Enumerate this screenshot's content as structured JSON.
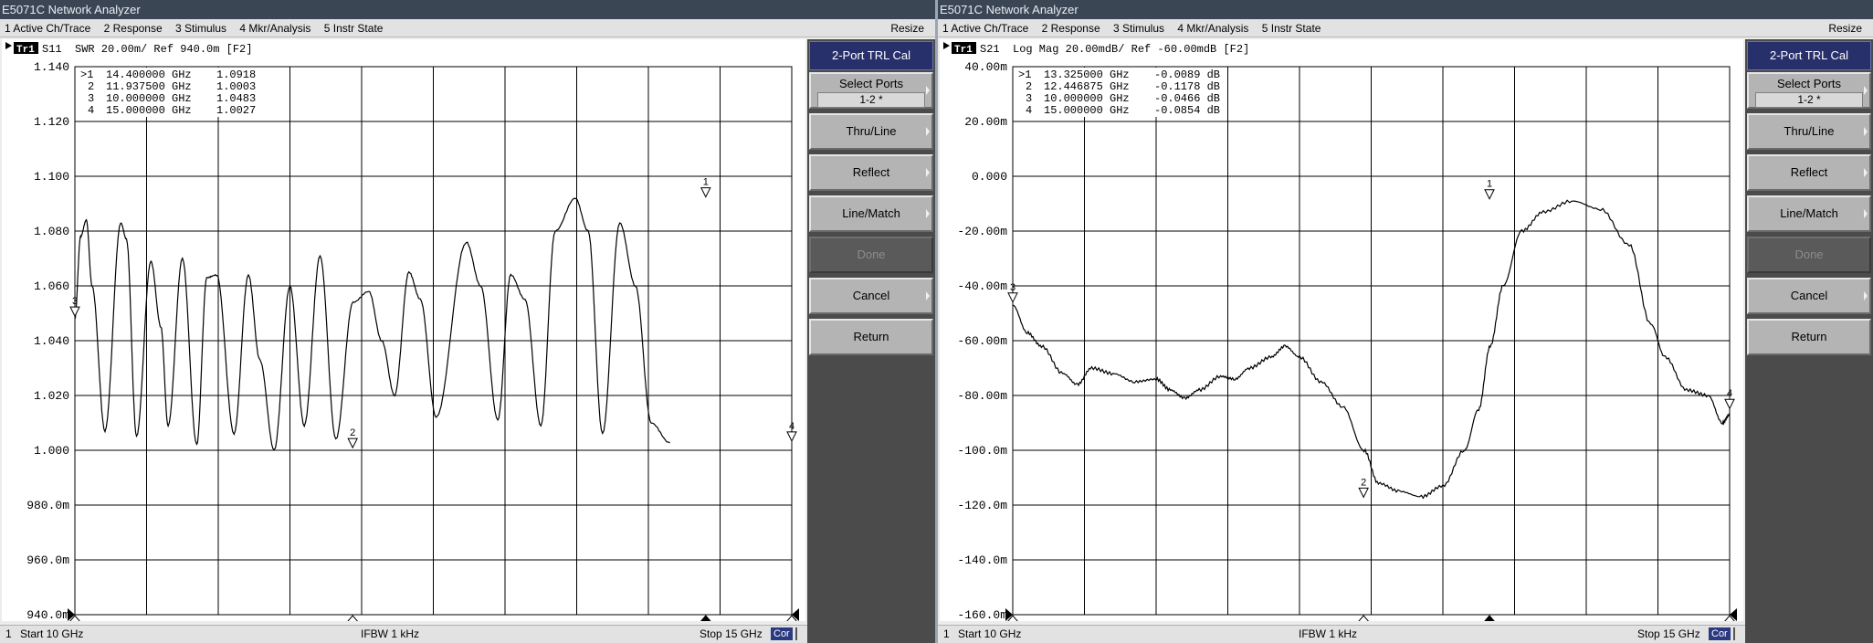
{
  "windows": [
    {
      "title": "E5071C Network Analyzer",
      "menu": [
        "1 Active Ch/Trace",
        "2 Response",
        "3 Stimulus",
        "4 Mkr/Analysis",
        "5 Instr State"
      ],
      "menu_right": "Resize",
      "trace_badge": "Tr1",
      "trace_header": "S11  SWR 20.00m/ Ref 940.0m [F2]",
      "markers": [
        {
          "id": ">1",
          "freq": "14.400000 GHz",
          "value": "1.0918"
        },
        {
          "id": "2",
          "freq": "11.937500 GHz",
          "value": "1.0003"
        },
        {
          "id": "3",
          "freq": "10.000000 GHz",
          "value": "1.0483"
        },
        {
          "id": "4",
          "freq": "15.000000 GHz",
          "value": "1.0027"
        }
      ],
      "status": {
        "channel": "1",
        "start": "Start 10 GHz",
        "ifbw": "IFBW 1 kHz",
        "stop": "Stop 15 GHz",
        "cor": "Cor"
      },
      "softkeys": {
        "title": "2-Port TRL Cal",
        "select_ports": "Select Ports",
        "select_ports_value": "1-2 *",
        "thru_line": "Thru/Line",
        "reflect": "Reflect",
        "line_match": "Line/Match",
        "done": "Done",
        "cancel": "Cancel",
        "return": "Return"
      },
      "colors": {
        "trace": "#000000",
        "grid": "#000000",
        "softkey_title": "#28306c",
        "cor_badge": "#2b3a80"
      },
      "chart_data": {
        "type": "line",
        "title": "S11  SWR 20.00m/ Ref 940.0m [F2]",
        "x_range": [
          10,
          15
        ],
        "x_unit": "GHz",
        "ylim": [
          0.94,
          1.14
        ],
        "y_ticks": [
          "1.140",
          "1.120",
          "1.100",
          "1.080",
          "1.060",
          "1.040",
          "1.020",
          "1.000",
          "980.0m",
          "960.0m",
          "940.0m"
        ],
        "grid": true,
        "series": [
          {
            "x": [
              10.0,
              10.04,
              10.08,
              10.12,
              10.21,
              10.32,
              10.36,
              10.43,
              10.53,
              10.6,
              10.65,
              10.75,
              10.85,
              10.92,
              10.99,
              11.11,
              11.21,
              11.29,
              11.39,
              11.5,
              11.6,
              11.71,
              11.82,
              11.94,
              12.05,
              12.14,
              12.23,
              12.33,
              12.41,
              12.52,
              12.73,
              12.83,
              12.95,
              13.04,
              13.14,
              13.25,
              13.35,
              13.49,
              13.58,
              13.68,
              13.8,
              13.91,
              14.02,
              14.15,
              14.27,
              14.4,
              14.52,
              14.63,
              14.76,
              14.88,
              15.0
            ],
            "y": [
              1.048,
              1.078,
              1.084,
              1.06,
              1.007,
              1.083,
              1.077,
              1.005,
              1.069,
              1.045,
              1.009,
              1.07,
              1.002,
              1.063,
              1.064,
              1.006,
              1.064,
              1.033,
              1.0,
              1.06,
              1.009,
              1.071,
              1.004,
              1.054,
              1.058,
              1.04,
              1.02,
              1.065,
              1.055,
              1.012,
              1.076,
              1.06,
              1.011,
              1.064,
              1.055,
              1.009,
              1.08,
              1.092,
              1.08,
              1.006,
              1.083,
              1.06,
              1.01,
              1.0027
            ]
          }
        ],
        "marker_points": [
          {
            "label": "1",
            "x": 14.4,
            "y": 1.0918
          },
          {
            "label": "2",
            "x": 11.9375,
            "y": 1.0003
          },
          {
            "label": "3",
            "x": 10.0,
            "y": 1.0483
          },
          {
            "label": "4",
            "x": 15.0,
            "y": 1.0027
          }
        ]
      }
    },
    {
      "title": "E5071C Network Analyzer",
      "menu": [
        "1 Active Ch/Trace",
        "2 Response",
        "3 Stimulus",
        "4 Mkr/Analysis",
        "5 Instr State"
      ],
      "menu_right": "Resize",
      "trace_badge": "Tr1",
      "trace_header": "S21  Log Mag 20.00mdB/ Ref -60.00mdB [F2]",
      "markers": [
        {
          "id": ">1",
          "freq": "13.325000 GHz",
          "value": "-0.0089 dB"
        },
        {
          "id": "2",
          "freq": "12.446875 GHz",
          "value": "-0.1178 dB"
        },
        {
          "id": "3",
          "freq": "10.000000 GHz",
          "value": "-0.0466 dB"
        },
        {
          "id": "4",
          "freq": "15.000000 GHz",
          "value": "-0.0854 dB"
        }
      ],
      "status": {
        "channel": "1",
        "start": "Start 10 GHz",
        "ifbw": "IFBW 1 kHz",
        "stop": "Stop 15 GHz",
        "cor": "Cor"
      },
      "softkeys": {
        "title": "2-Port TRL Cal",
        "select_ports": "Select Ports",
        "select_ports_value": "1-2 *",
        "thru_line": "Thru/Line",
        "reflect": "Reflect",
        "line_match": "Line/Match",
        "done": "Done",
        "cancel": "Cancel",
        "return": "Return"
      },
      "colors": {
        "trace": "#000000",
        "grid": "#000000",
        "softkey_title": "#28306c",
        "cor_badge": "#2b3a80"
      },
      "chart_data": {
        "type": "line",
        "title": "S21  Log Mag 20.00mdB/ Ref -60.00mdB [F2]",
        "x_range": [
          10,
          15
        ],
        "x_unit": "GHz",
        "ylim": [
          -160,
          40
        ],
        "y_unit": "mdB",
        "y_ticks": [
          "40.00m",
          "20.00m",
          "0.000",
          "-20.00m",
          "-40.00m",
          "-60.00m",
          "-80.00m",
          "-100.0m",
          "-120.0m",
          "-140.0m",
          "-160.0m"
        ],
        "grid": true,
        "series": [
          {
            "x": [
              10.0,
              10.1,
              10.2,
              10.35,
              10.45,
              10.55,
              10.7,
              10.85,
              11.0,
              11.1,
              11.2,
              11.3,
              11.45,
              11.55,
              11.65,
              11.8,
              11.9,
              12.0,
              12.15,
              12.3,
              12.45,
              12.55,
              12.7,
              12.85,
              13.0,
              13.15,
              13.25,
              13.33,
              13.42,
              13.55,
              13.7,
              13.9,
              14.1,
              14.3,
              14.45,
              14.55,
              14.7,
              14.85,
              14.95,
              15.0
            ],
            "y": [
              -47,
              -57,
              -62,
              -72,
              -76,
              -70,
              -72,
              -75,
              -74,
              -78,
              -81,
              -78,
              -73,
              -74,
              -70,
              -66,
              -62,
              -66,
              -75,
              -84,
              -100,
              -112,
              -115,
              -117,
              -113,
              -100,
              -85,
              -62,
              -40,
              -20,
              -13,
              -9,
              -12,
              -25,
              -54,
              -66,
              -78,
              -80,
              -90,
              -87,
              -83,
              -88,
              -91,
              -85
            ]
          }
        ],
        "marker_points": [
          {
            "label": "1",
            "x": 13.325,
            "y": -8.9
          },
          {
            "label": "2",
            "x": 12.446875,
            "y": -117.8
          },
          {
            "label": "3",
            "x": 10.0,
            "y": -46.6
          },
          {
            "label": "4",
            "x": 15.0,
            "y": -85.4
          }
        ]
      }
    }
  ]
}
